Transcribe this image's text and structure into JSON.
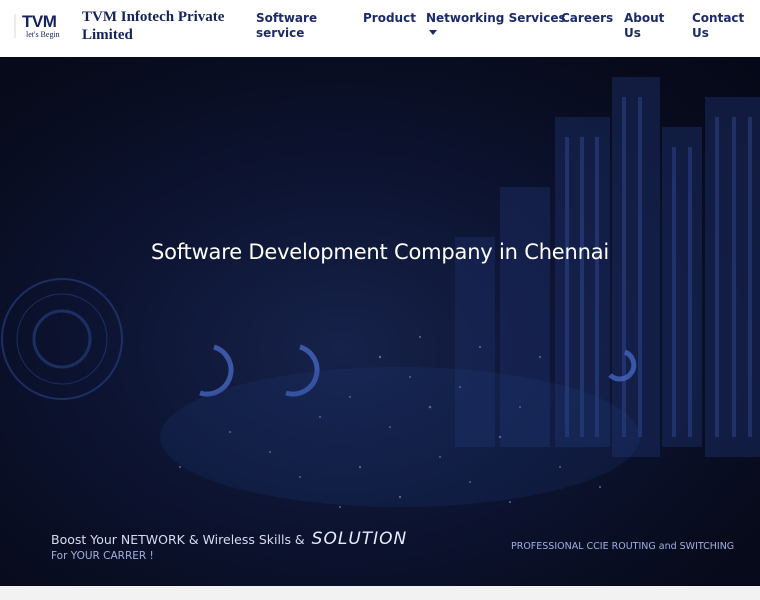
{
  "header": {
    "logo_mark": "TVM",
    "logo_tagline": "let's Begin",
    "brand_name": "TVM Infotech Private Limited",
    "nav": [
      {
        "label": "Software service"
      },
      {
        "label": "Product"
      },
      {
        "label": "Networking Services",
        "has_dropdown": true
      },
      {
        "label": "Careers"
      },
      {
        "label": "About Us"
      },
      {
        "label": "Contact Us"
      }
    ]
  },
  "hero": {
    "title": "Software Development Company in Chennai",
    "boost_text": "Boost Your NETWORK & Wireless Skills &",
    "boost_emphasis": "SOLUTION",
    "carrer_text": "For YOUR CARRER !",
    "ccie_text": "PROFESSIONAL CCIE ROUTING and SWITCHING"
  },
  "colors": {
    "nav_text": "#1b2a6b",
    "brand_text": "#14235a",
    "hero_background": "#0a1028",
    "hero_title": "#ffffff"
  }
}
